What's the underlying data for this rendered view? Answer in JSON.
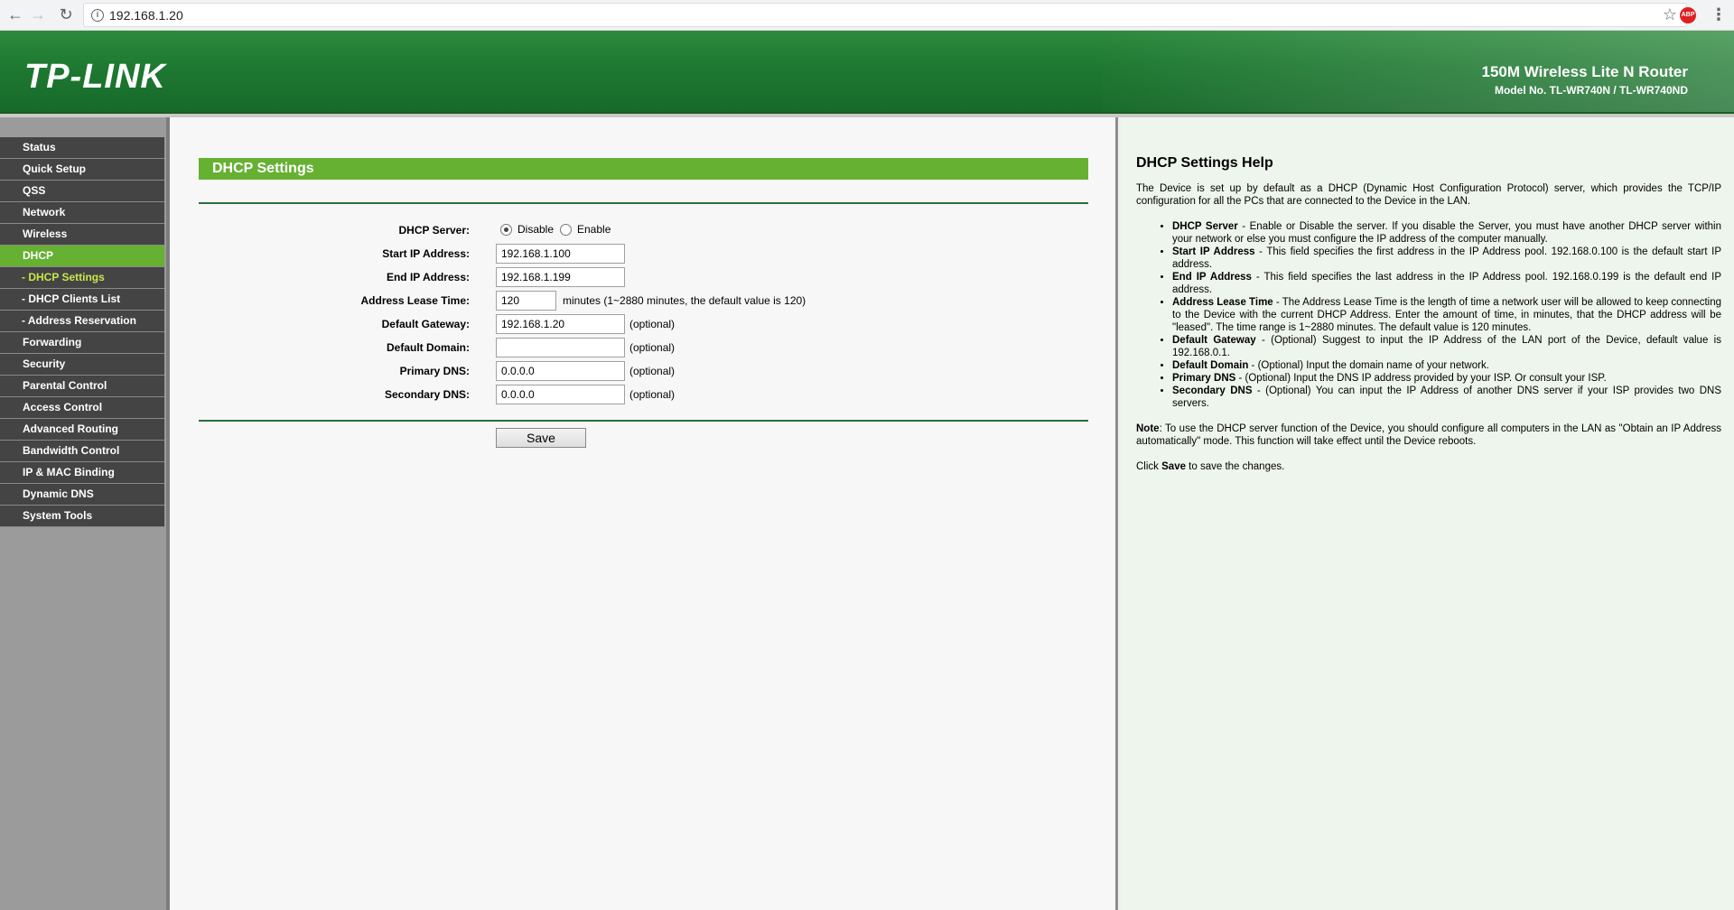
{
  "browser": {
    "url": "192.168.1.20"
  },
  "banner": {
    "logo": "TP-LINK",
    "product_name": "150M Wireless Lite N Router",
    "model_no": "Model No. TL-WR740N / TL-WR740ND"
  },
  "sidebar": {
    "items": [
      {
        "label": "Status"
      },
      {
        "label": "Quick Setup"
      },
      {
        "label": "QSS"
      },
      {
        "label": "Network"
      },
      {
        "label": "Wireless"
      },
      {
        "label": "DHCP"
      },
      {
        "label": "- DHCP Settings"
      },
      {
        "label": "- DHCP Clients List"
      },
      {
        "label": "- Address Reservation"
      },
      {
        "label": "Forwarding"
      },
      {
        "label": "Security"
      },
      {
        "label": "Parental Control"
      },
      {
        "label": "Access Control"
      },
      {
        "label": "Advanced Routing"
      },
      {
        "label": "Bandwidth Control"
      },
      {
        "label": "IP & MAC Binding"
      },
      {
        "label": "Dynamic DNS"
      },
      {
        "label": "System Tools"
      }
    ]
  },
  "main": {
    "title": "DHCP Settings",
    "dhcp_server": {
      "label": "DHCP Server:",
      "disable_label": "Disable",
      "enable_label": "Enable",
      "selected": "Disable"
    },
    "fields": {
      "start_ip": {
        "label": "Start IP Address:",
        "value": "192.168.1.100"
      },
      "end_ip": {
        "label": "End IP Address:",
        "value": "192.168.1.199"
      },
      "lease_time": {
        "label": "Address Lease Time:",
        "value": "120",
        "hint": "minutes (1~2880 minutes, the default value is 120)"
      },
      "gateway": {
        "label": "Default Gateway:",
        "value": "192.168.1.20",
        "hint": "(optional)"
      },
      "domain": {
        "label": "Default Domain:",
        "value": "",
        "hint": "(optional)"
      },
      "primary_dns": {
        "label": "Primary DNS:",
        "value": "0.0.0.0",
        "hint": "(optional)"
      },
      "secondary_dns": {
        "label": "Secondary DNS:",
        "value": "0.0.0.0",
        "hint": "(optional)"
      }
    },
    "save_label": "Save"
  },
  "help": {
    "title": "DHCP Settings Help",
    "intro": "The Device is set up by default as a DHCP (Dynamic Host Configuration Protocol) server, which provides the TCP/IP configuration for all the PCs that are connected to the Device in the LAN.",
    "items": [
      {
        "term": "DHCP Server",
        "text": " - Enable or Disable the server. If you disable the Server, you must have another DHCP server within your network or else you must configure the IP address of the computer manually."
      },
      {
        "term": "Start IP Address",
        "text": " - This field specifies the first address in the IP Address pool. 192.168.0.100 is the default start IP address."
      },
      {
        "term": "End IP Address",
        "text": " - This field specifies the last address in the IP Address pool. 192.168.0.199 is the default end IP address."
      },
      {
        "term": "Address Lease Time",
        "text": " - The Address Lease Time is the length of time a network user will be allowed to keep connecting to the Device with the current DHCP Address. Enter the amount of time, in minutes, that the DHCP address will be \"leased\". The time range is 1~2880 minutes. The default value is 120 minutes."
      },
      {
        "term": "Default Gateway",
        "text": " - (Optional) Suggest to input the IP Address of the LAN port of the Device, default value is 192.168.0.1."
      },
      {
        "term": "Default Domain",
        "text": " - (Optional) Input the domain name of your network."
      },
      {
        "term": "Primary DNS",
        "text": " - (Optional) Input the DNS IP address provided by your ISP. Or consult your ISP."
      },
      {
        "term": "Secondary DNS",
        "text": " - (Optional) You can input the IP Address of another DNS server if your ISP provides two DNS servers."
      }
    ],
    "note_term": "Note",
    "note_text": ": To use the DHCP server function of the Device, you should configure all computers in the LAN as \"Obtain an IP Address automatically\" mode. This function will take effect until the Device reboots.",
    "click_prefix": "Click ",
    "click_term": "Save",
    "click_suffix": " to save the changes."
  },
  "colors": {
    "banner_green": "#1f7a32",
    "accent_green": "#66b032",
    "menu_dark": "#444444",
    "sub_active": "#c6e84a",
    "help_bg": "#eef5ec"
  }
}
